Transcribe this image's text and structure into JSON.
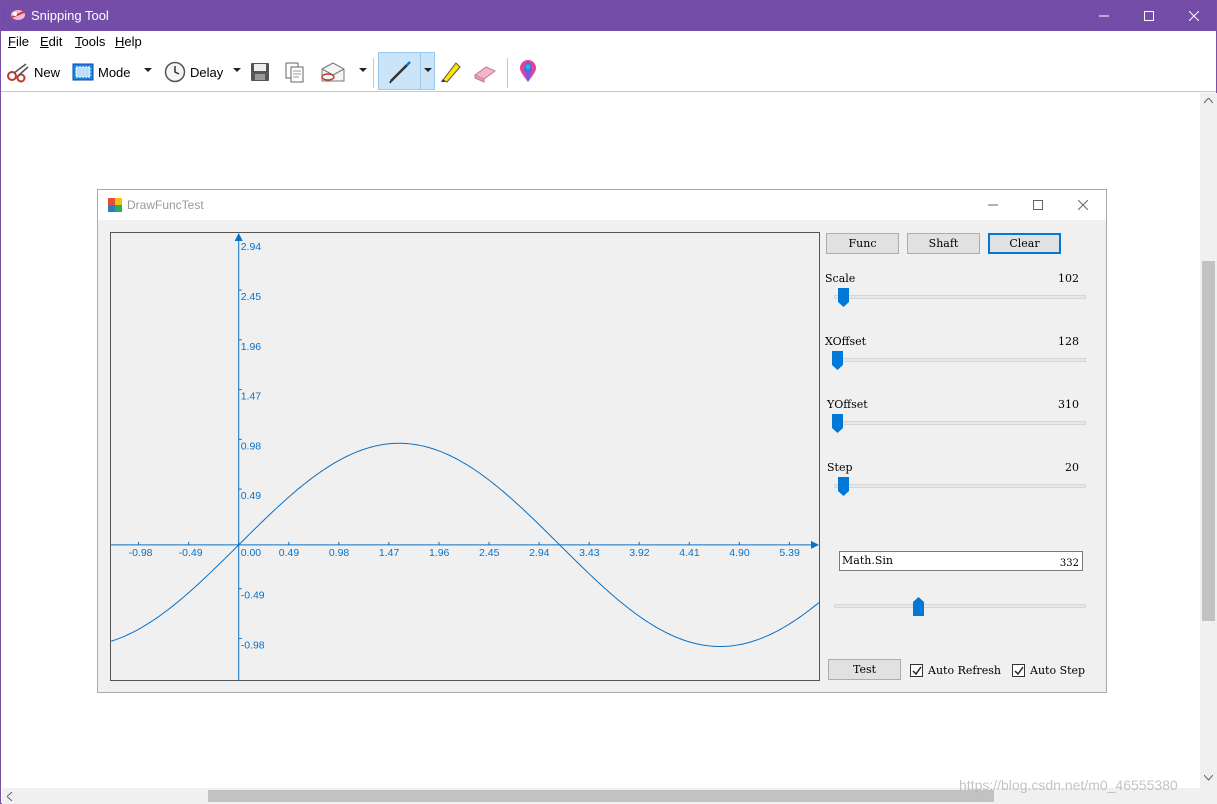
{
  "window": {
    "title": "Snipping Tool",
    "accent": "#744da9"
  },
  "menu": [
    {
      "label": "File",
      "key": "F",
      "rest": "ile"
    },
    {
      "label": "Edit",
      "key": "E",
      "rest": "dit"
    },
    {
      "label": "Tools",
      "key": "T",
      "rest": "ools"
    },
    {
      "label": "Help",
      "key": "H",
      "rest": "elp"
    }
  ],
  "toolbar": {
    "new_label": "New",
    "mode_label": "Mode",
    "delay_label": "Delay",
    "icons": [
      "scissors-icon",
      "mode-icon",
      "clock-icon",
      "save-icon",
      "copy-icon",
      "send-icon",
      "pen-icon",
      "highlighter-icon",
      "eraser-icon",
      "paint3d-icon"
    ]
  },
  "inner_window": {
    "title": "DrawFuncTest",
    "buttons": {
      "func": "Func",
      "shaft": "Shaft",
      "clear": "Clear"
    },
    "sliders": {
      "scale": {
        "label": "Scale",
        "value": "102"
      },
      "xoffset": {
        "label": "XOffset",
        "value": "128"
      },
      "yoffset": {
        "label": "YOffset",
        "value": "310"
      },
      "step": {
        "label": "Step",
        "value": "20"
      }
    },
    "func_input": "Math.Sin",
    "func_slider_value": "332",
    "test_label": "Test",
    "auto_refresh_label": "Auto Refresh",
    "auto_step_label": "Auto Step",
    "auto_refresh_checked": true,
    "auto_step_checked": true
  },
  "chart_data": {
    "type": "line",
    "function": "sin",
    "color": "#0a71c4",
    "x_ticks": [
      "-0.98",
      "-0.49",
      "0.00",
      "0.49",
      "0.98",
      "1.47",
      "1.96",
      "2.45",
      "2.94",
      "3.43",
      "3.92",
      "4.41",
      "4.90",
      "5.39"
    ],
    "y_ticks": [
      "2.94",
      "2.45",
      "1.96",
      "1.47",
      "0.98",
      "0.49",
      "-0.49",
      "-0.98"
    ],
    "xlim": [
      -1.25,
      5.68
    ],
    "ylim": [
      -1.33,
      3.07
    ]
  },
  "watermark": "https://blog.csdn.net/m0_46555380"
}
